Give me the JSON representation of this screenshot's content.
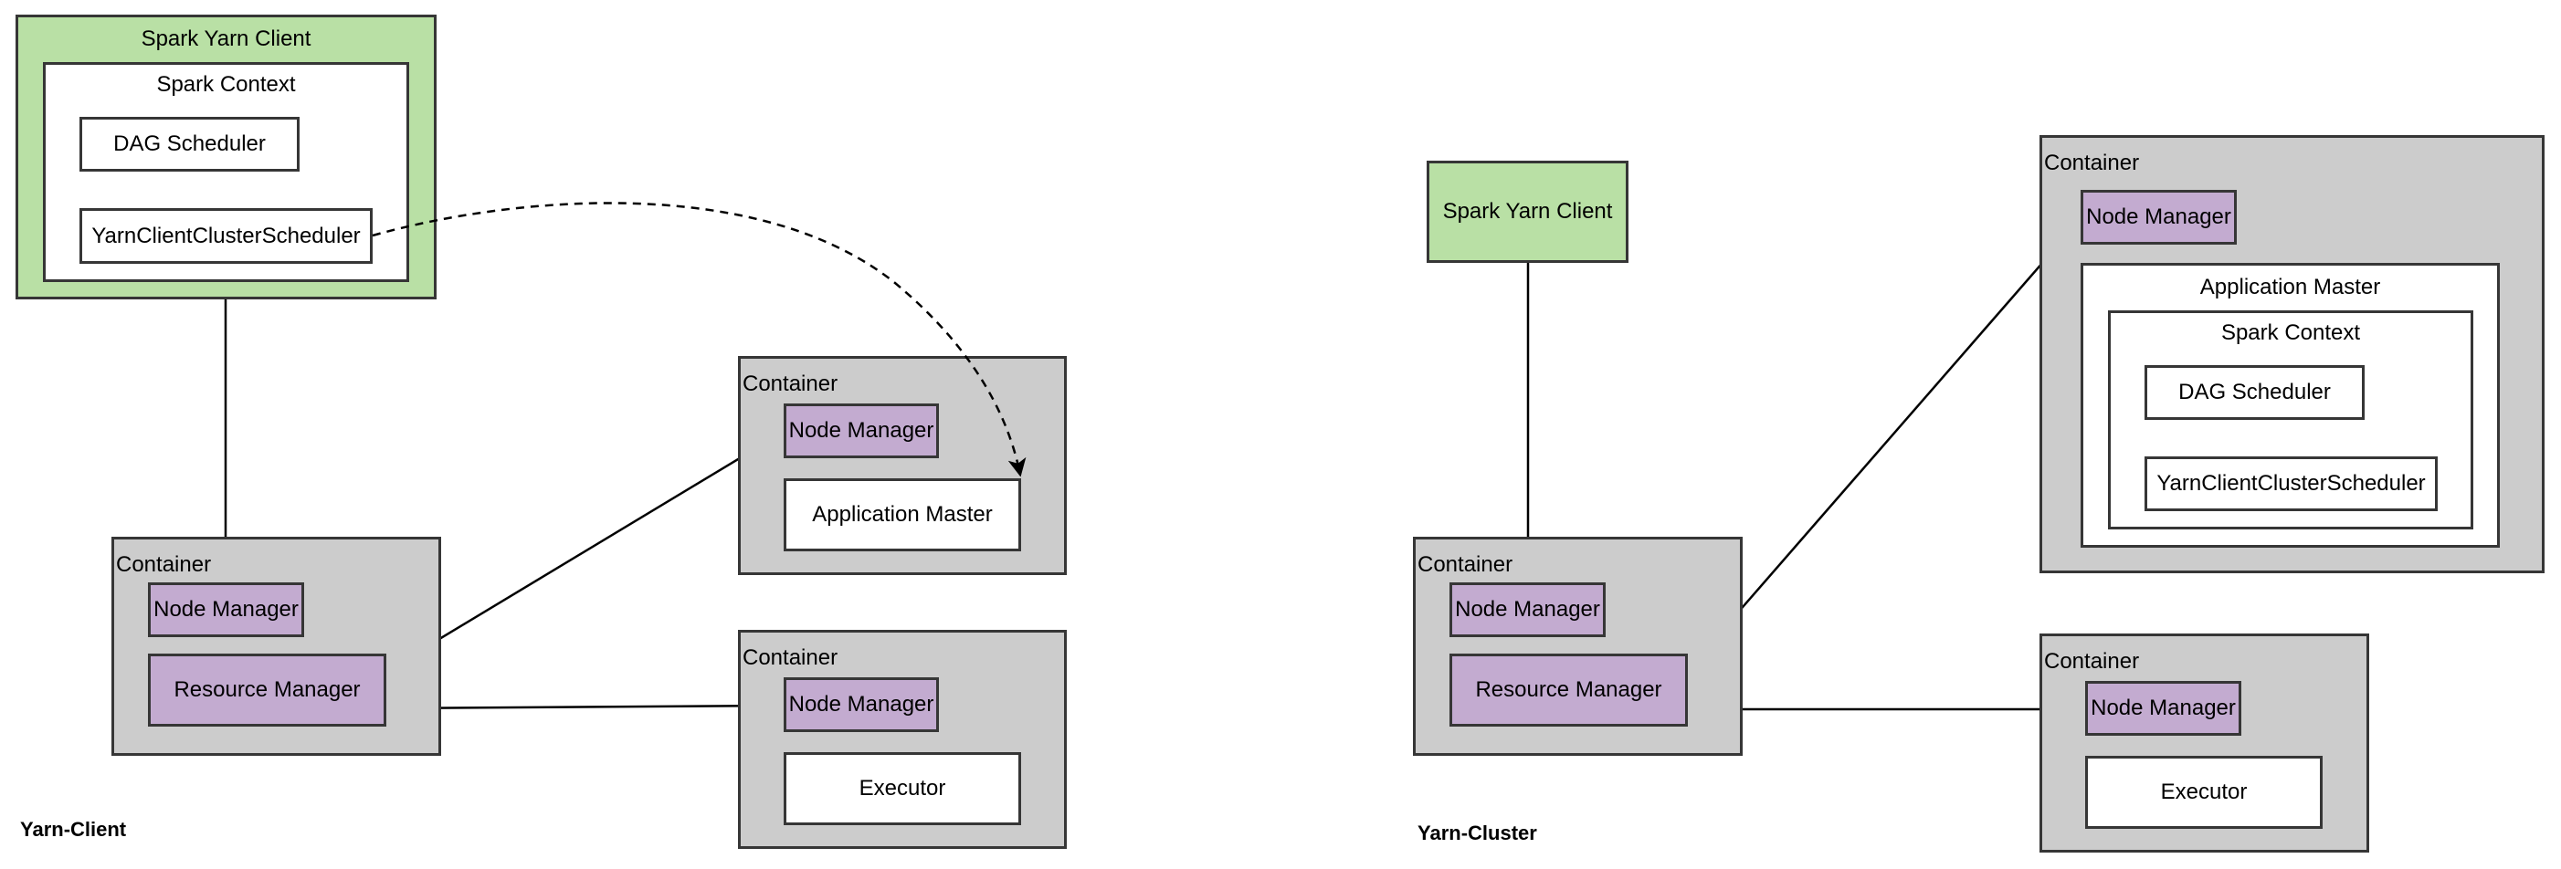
{
  "colors": {
    "client_fill": "#b9e0a5",
    "container_fill": "#cccccc",
    "manager_fill": "#c3abd0",
    "component_fill": "#ffffff",
    "stroke": "#363636"
  },
  "yarn_client": {
    "title": "Yarn-Client",
    "spark_yarn_client": {
      "label": "Spark Yarn Client",
      "spark_context": {
        "label": "Spark Context",
        "dag_scheduler": "DAG Scheduler",
        "cluster_scheduler": "YarnClientClusterScheduler"
      }
    },
    "rm_container": {
      "label": "Container",
      "node_manager": "Node Manager",
      "resource_manager": "Resource Manager"
    },
    "am_container": {
      "label": "Container",
      "node_manager": "Node Manager",
      "application_master": "Application Master"
    },
    "executor_container": {
      "label": "Container",
      "node_manager": "Node Manager",
      "executor": "Executor"
    },
    "edges": [
      {
        "from": "YarnClientClusterScheduler",
        "to": "Node Manager (RM container)",
        "style": "solid"
      },
      {
        "from": "Resource Manager",
        "to": "Node Manager (AM container)",
        "style": "solid"
      },
      {
        "from": "Resource Manager",
        "to": "Node Manager (Executor container)",
        "style": "solid"
      },
      {
        "from": "YarnClientClusterScheduler",
        "to": "Application Master",
        "style": "dashed-arrow"
      }
    ]
  },
  "yarn_cluster": {
    "title": "Yarn-Cluster",
    "spark_yarn_client": {
      "label": "Spark Yarn Client"
    },
    "rm_container": {
      "label": "Container",
      "node_manager": "Node Manager",
      "resource_manager": "Resource Manager"
    },
    "am_container": {
      "label": "Container",
      "node_manager": "Node Manager",
      "application_master": {
        "label": "Application Master",
        "spark_context": {
          "label": "Spark Context",
          "dag_scheduler": "DAG Scheduler",
          "cluster_scheduler": "YarnClientClusterScheduler"
        }
      }
    },
    "executor_container": {
      "label": "Container",
      "node_manager": "Node Manager",
      "executor": "Executor"
    },
    "edges": [
      {
        "from": "Spark Yarn Client",
        "to": "Node Manager (RM container)",
        "style": "solid"
      },
      {
        "from": "Resource Manager",
        "to": "Node Manager (AM container)",
        "style": "solid"
      },
      {
        "from": "Resource Manager",
        "to": "Node Manager (Executor container)",
        "style": "solid"
      }
    ]
  }
}
